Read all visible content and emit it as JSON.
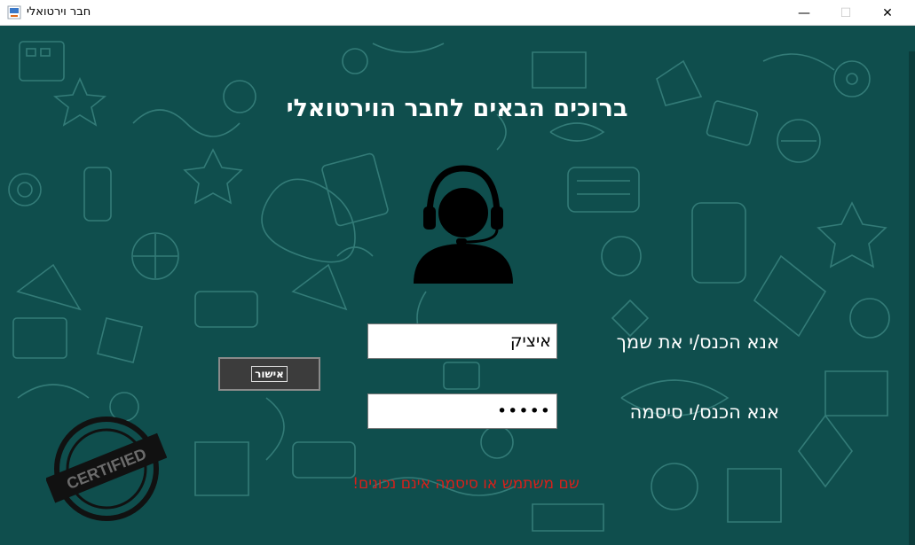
{
  "window": {
    "title": "חבר וירטואלי",
    "controls": {
      "minimize": "—",
      "maximize": "☐",
      "close": "✕"
    }
  },
  "main": {
    "heading": "ברוכים הבאים לחבר הוירטואלי",
    "name_label": "אנא הכנס/י את שמך",
    "name_value": "איציק",
    "password_label": "אנא הכנס/י סיסמה",
    "password_value": "•••••",
    "ok_button_label": "אישור",
    "error_message": "שם משתמש או סיסמה אינם נכונים!"
  },
  "badge": {
    "text": "CERTIFIED",
    "icon": "certified-stamp-icon"
  },
  "avatar": {
    "icon": "customer-support-headset-icon"
  },
  "colors": {
    "background": "#0f4e4d",
    "doodles": "#3f8a86",
    "text": "#ffffff",
    "error": "#d8201a",
    "button": "#3c3c3c"
  }
}
